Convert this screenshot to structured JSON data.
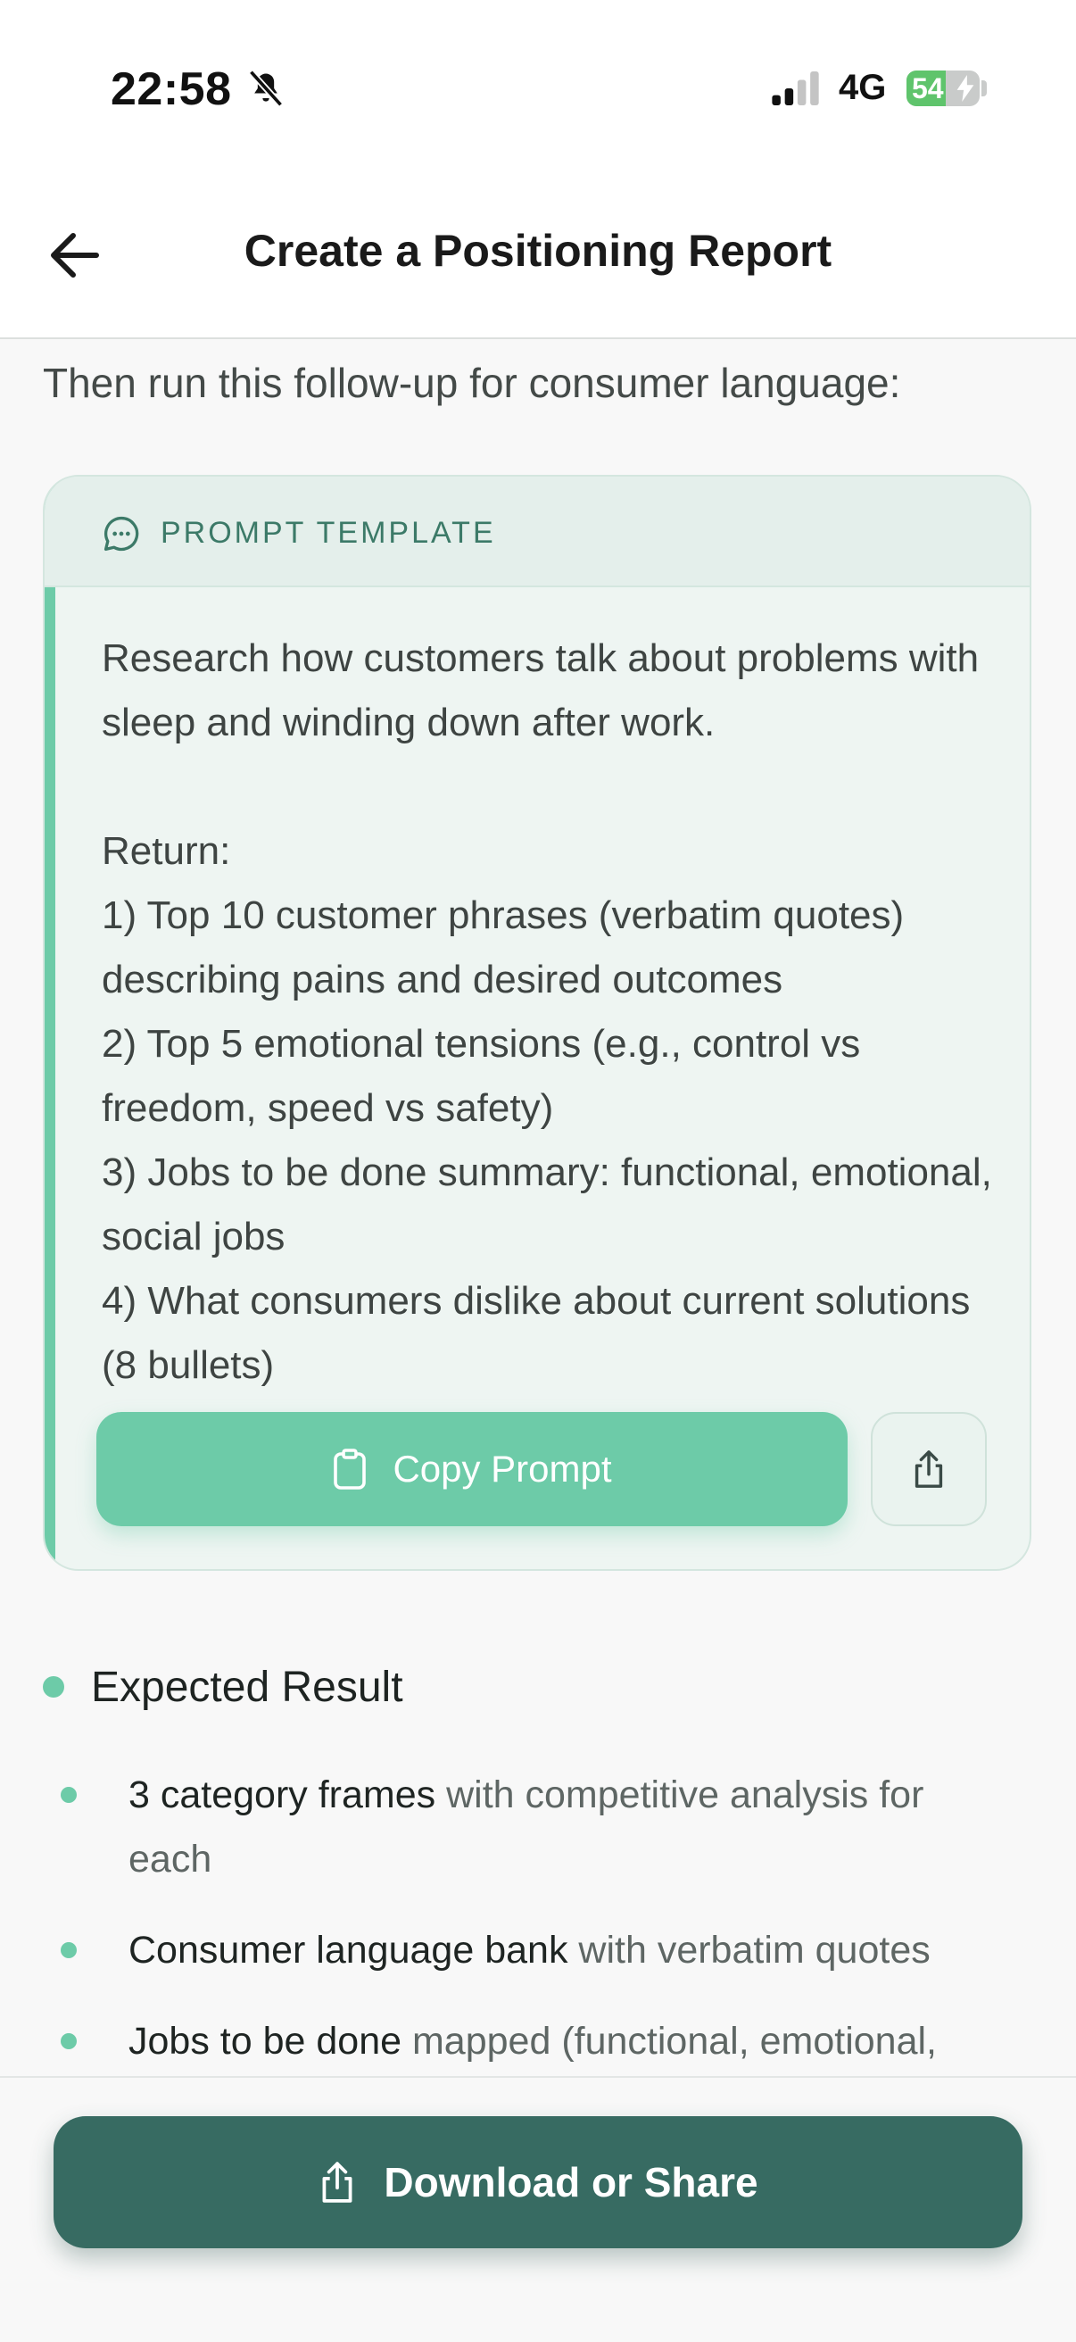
{
  "status_bar": {
    "time": "22:58",
    "network": "4G",
    "battery": "54",
    "battery_level": 0.54
  },
  "header": {
    "title": "Create a Positioning Report",
    "back_icon": "arrow-left-icon"
  },
  "intro": "Then run this follow-up for consumer language:",
  "prompt_card": {
    "label": "PROMPT TEMPLATE",
    "icon": "chat-bubble-icon",
    "body": "Research how customers talk about problems with sleep and winding down after work.\n\nReturn:\n1) Top 10 customer phrases (verbatim quotes) describing pains and desired outcomes\n2) Top 5 emotional tensions (e.g., control vs freedom, speed vs safety)\n3) Jobs to be done summary: functional, emotional, social jobs\n4) What consumers dislike about current solutions (8 bullets)",
    "copy_label": "Copy Prompt",
    "share_icon": "share-icon"
  },
  "expected_result": {
    "title": "Expected Result",
    "items": [
      {
        "strong": "3 category frames",
        "rest": " with competitive analysis for each"
      },
      {
        "strong": "Consumer language bank",
        "rest": " with verbatim quotes"
      },
      {
        "strong": "Jobs to be done",
        "rest": " mapped (functional, emotional,"
      }
    ]
  },
  "bottom": {
    "download_label": "Download or Share"
  },
  "colors": {
    "accent": "#6dcba8",
    "primary_button": "#376b62",
    "card_background": "#eef5f2"
  }
}
